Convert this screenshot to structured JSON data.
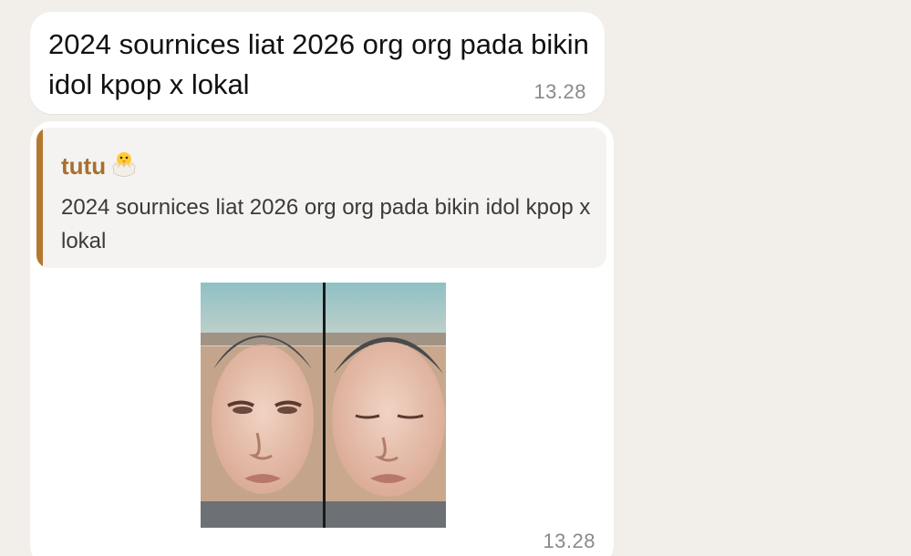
{
  "messages": [
    {
      "text": "2024 sournices liat 2026 org org pada bikin idol kpop x lokal",
      "time": "13.28"
    },
    {
      "reply": {
        "author": "tutu",
        "author_emoji": "hatching-chick-icon",
        "text": "2024 sournices liat 2026 org org pada bikin idol kpop x lokal"
      },
      "media": {
        "type": "image",
        "description_icon": "side-by-side-photo-icon"
      },
      "time": "13.28"
    }
  ],
  "colors": {
    "background": "#f2efea",
    "bubble": "#ffffff",
    "quote_bar": "#b5782e",
    "quote_author": "#a8702d",
    "time": "#8a8a8a"
  }
}
